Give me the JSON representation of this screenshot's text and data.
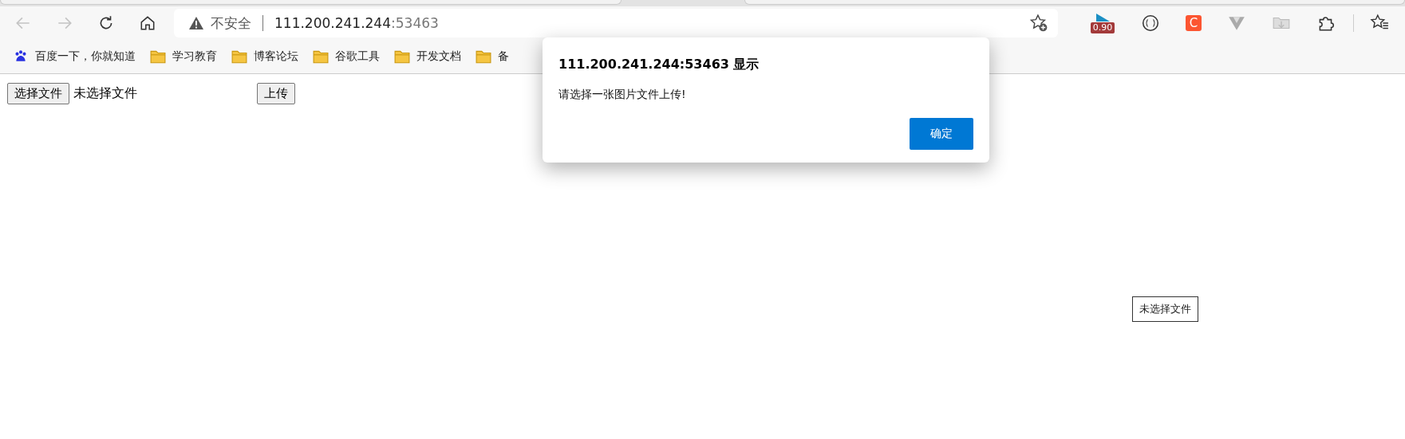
{
  "toolbar": {
    "security_label": "不安全",
    "url_host": "111.200.241.244",
    "url_port": ":53463",
    "extensions": [
      {
        "kind": "meter",
        "badge": "0.90"
      },
      {
        "kind": "braces"
      },
      {
        "kind": "letter",
        "letter": "C"
      },
      {
        "kind": "vee"
      },
      {
        "kind": "folder"
      },
      {
        "kind": "puzzle"
      }
    ]
  },
  "bookmarks": [
    {
      "kind": "paw",
      "label": "百度一下，你就知道"
    },
    {
      "kind": "folder",
      "label": "学习教育"
    },
    {
      "kind": "folder",
      "label": "博客论坛"
    },
    {
      "kind": "folder",
      "label": "谷歌工具"
    },
    {
      "kind": "folder",
      "label": "开发文档"
    },
    {
      "kind": "folder",
      "label": "备"
    }
  ],
  "page": {
    "file_button": "选择文件",
    "file_status": "未选择文件",
    "upload_button": "上传",
    "tooltip": "未选择文件"
  },
  "dialog": {
    "title": "111.200.241.244:53463 显示",
    "message": "请选择一张图片文件上传!",
    "ok_button": "确定"
  }
}
